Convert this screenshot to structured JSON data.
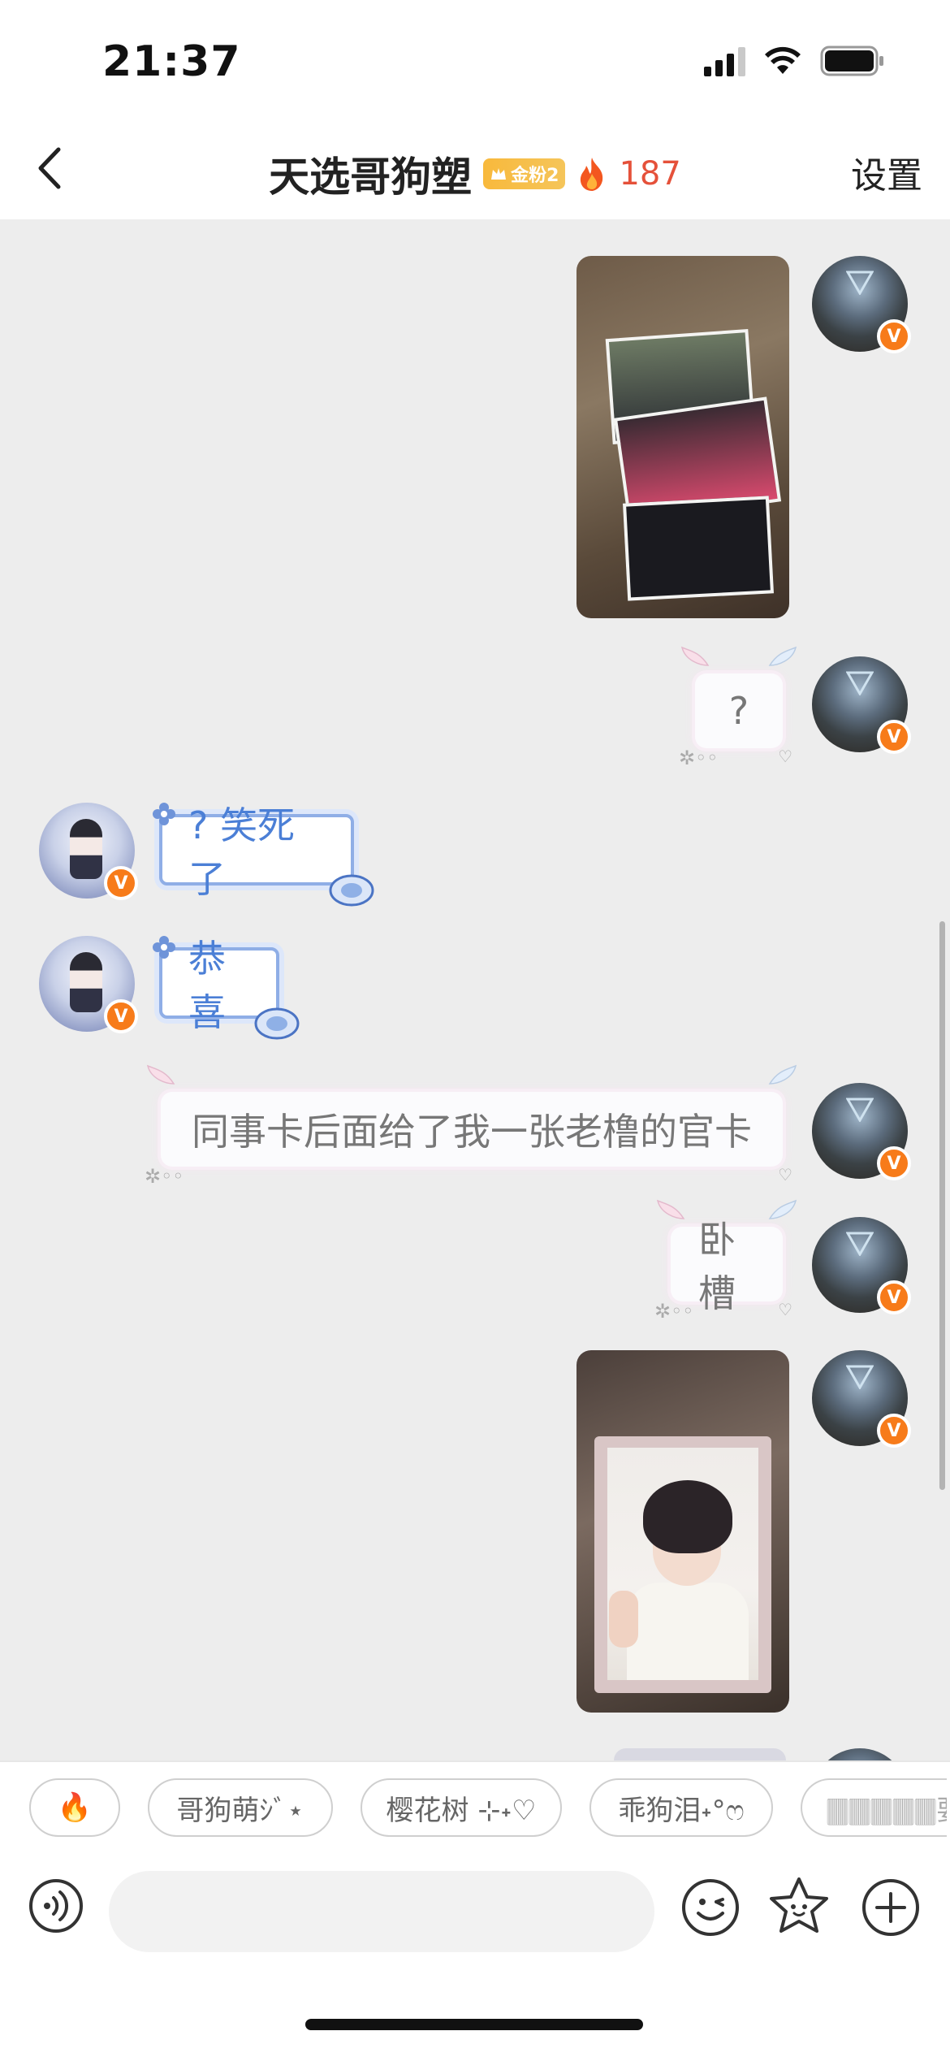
{
  "status_bar": {
    "time": "21:37"
  },
  "header": {
    "title": "天选哥狗塑",
    "fan_badge": "金粉2",
    "fire_count": "187",
    "settings_label": "设置"
  },
  "messages": [
    {
      "side": "right",
      "type": "image"
    },
    {
      "side": "right",
      "type": "text",
      "text": "?"
    },
    {
      "side": "left",
      "type": "text",
      "text": "? 笑死了"
    },
    {
      "side": "left",
      "type": "text",
      "text": "恭喜"
    },
    {
      "side": "right",
      "type": "text",
      "text": "同事卡后面给了我一张老橹的官卡"
    },
    {
      "side": "right",
      "type": "text",
      "text": "卧槽"
    },
    {
      "side": "right",
      "type": "image"
    }
  ],
  "quick_replies": [
    "🔥",
    "哥狗萌ｼﾞ⋆",
    "樱花树 ⊹˖♡",
    "乖狗泪˖°ෆ",
    "🀫🀫🀫🀫🀫要"
  ],
  "input": {
    "placeholder": ""
  },
  "colors": {
    "accent_orange": "#f77b1a",
    "fire_red": "#e5513a",
    "blue_bubble": "#4b7fd6",
    "chat_bg": "#ededed"
  },
  "icons": [
    "back-icon",
    "crown-icon",
    "flame-icon",
    "voice-icon",
    "emoji-icon",
    "sticker-icon",
    "plus-icon"
  ]
}
